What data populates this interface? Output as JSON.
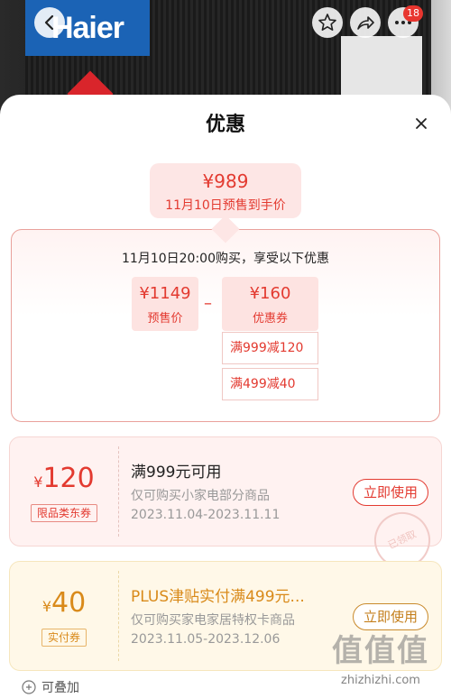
{
  "header": {
    "brand_logo": "Haier",
    "badge_count": "18",
    "icons": [
      "back-icon",
      "star-icon",
      "share-icon",
      "more-icon"
    ]
  },
  "sheet": {
    "title": "优惠",
    "final_price": "¥989",
    "final_price_label": "11月10日预售到手价",
    "detail_heading": "11月10日20:00购买，享受以下优惠",
    "presale_price": "¥1149",
    "presale_label": "预售价",
    "minus_sign": "–",
    "coupon_total": "¥160",
    "coupon_total_label": "优惠券",
    "coupon_breakdown": [
      "满999减120",
      "满499减40"
    ]
  },
  "coupons": [
    {
      "currency": "¥",
      "amount": "120",
      "tag": "限品类东券",
      "title": "满999元可用",
      "desc": "仅可购买小家电部分商品",
      "dates": "2023.11.04-2023.11.11",
      "button": "立即使用",
      "stamp": "已领取"
    },
    {
      "currency": "¥",
      "amount": "40",
      "tag": "实付券",
      "title": "PLUS津贴实付满499元...",
      "desc": "仅可购买家电家居特权卡商品",
      "dates": "2023.11.05-2023.12.06",
      "button": "立即使用"
    }
  ],
  "footer": {
    "stackable_label": "可叠加"
  },
  "watermark": {
    "glyphs": "值值值",
    "site": "zhizhizhi.com"
  },
  "colors": {
    "accent_red": "#e33a30",
    "gold_text": "#d98a1a",
    "brand_blue": "#1b63b5"
  }
}
